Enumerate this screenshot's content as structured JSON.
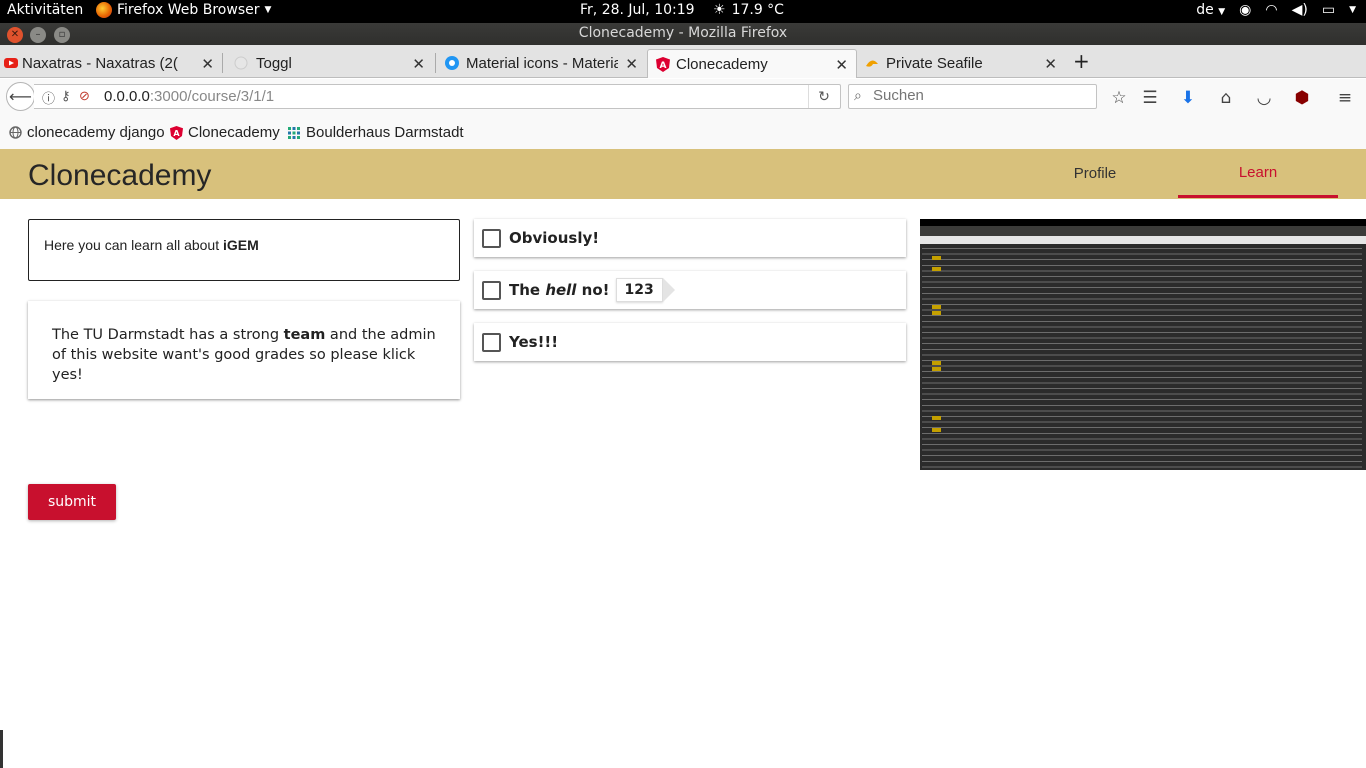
{
  "gnome": {
    "activities": "Aktivitäten",
    "app_name": "Firefox Web Browser",
    "clock": "Fr, 28. Jul, 10:19",
    "weather": "17.9 °C",
    "keyboard": "de"
  },
  "window": {
    "title": "Clonecademy - Mozilla Firefox"
  },
  "tabs": [
    {
      "label": "Naxatras - Naxatras (2(",
      "favicon": "youtube-icon"
    },
    {
      "label": "Toggl",
      "favicon": "toggl-icon"
    },
    {
      "label": "Material icons - Materia",
      "favicon": "material-icon"
    },
    {
      "label": "Clonecademy",
      "favicon": "angular-icon"
    },
    {
      "label": "Private Seafile",
      "favicon": "seafile-icon"
    }
  ],
  "navbar": {
    "url_host": "0.0.0.0",
    "url_rest": ":3000/course/3/1/1",
    "search_placeholder": "Suchen"
  },
  "bookmarks": [
    {
      "label": "clonecademy django",
      "icon": "globe-icon"
    },
    {
      "label": "Clonecademy",
      "icon": "angular-icon"
    },
    {
      "label": "Boulderhaus Darmstadt",
      "icon": "grid-icon"
    }
  ],
  "app": {
    "brand": "Clonecademy",
    "nav": {
      "profile": "Profile",
      "learn": "Learn"
    },
    "intro": {
      "prefix": "Here you can learn all about ",
      "strong": "iGEM"
    },
    "info": {
      "part1": "The TU Darmstadt has a strong ",
      "strong": "team",
      "part2": " and the admin of this website want's good grades so please klick yes!"
    },
    "options": {
      "o1": "Obviously!",
      "o2_pre": "The ",
      "o2_em": "hell",
      "o2_post": " no!",
      "o2_badge": "123",
      "o3": "Yes!!!"
    },
    "submit": "submit"
  },
  "colors": {
    "toolbar": "#d8c17c",
    "accent": "#c8102e"
  }
}
